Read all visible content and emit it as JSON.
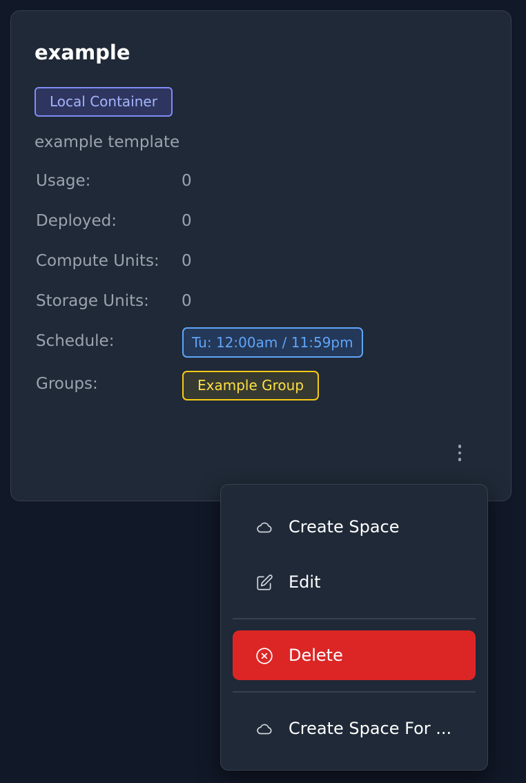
{
  "card": {
    "title": "example",
    "type_badge": "Local Container",
    "description": "example template",
    "rows": [
      {
        "label": "Usage:",
        "value": "0"
      },
      {
        "label": "Deployed:",
        "value": "0"
      },
      {
        "label": "Compute Units:",
        "value": "0"
      },
      {
        "label": "Storage Units:",
        "value": "0"
      },
      {
        "label": "Schedule:"
      },
      {
        "label": "Groups:"
      }
    ],
    "schedule": "Tu: 12:00am / 11:59pm",
    "group": "Example Group",
    "more_icon": "kebab-menu-icon"
  },
  "menu": {
    "items": [
      {
        "label": "Create Space",
        "icon": "cloud-icon"
      },
      {
        "label": "Edit",
        "icon": "edit-icon"
      },
      {
        "label": "Delete",
        "icon": "circle-x-icon"
      },
      {
        "label": "Create Space For ...",
        "icon": "cloud-icon"
      }
    ]
  },
  "colors": {
    "background": "#111827",
    "card": "#1f2937",
    "border": "#374151",
    "type_badge": "#818cf8",
    "schedule_badge": "#60a5fa",
    "group_badge": "#facc15",
    "danger": "#dc2626"
  }
}
